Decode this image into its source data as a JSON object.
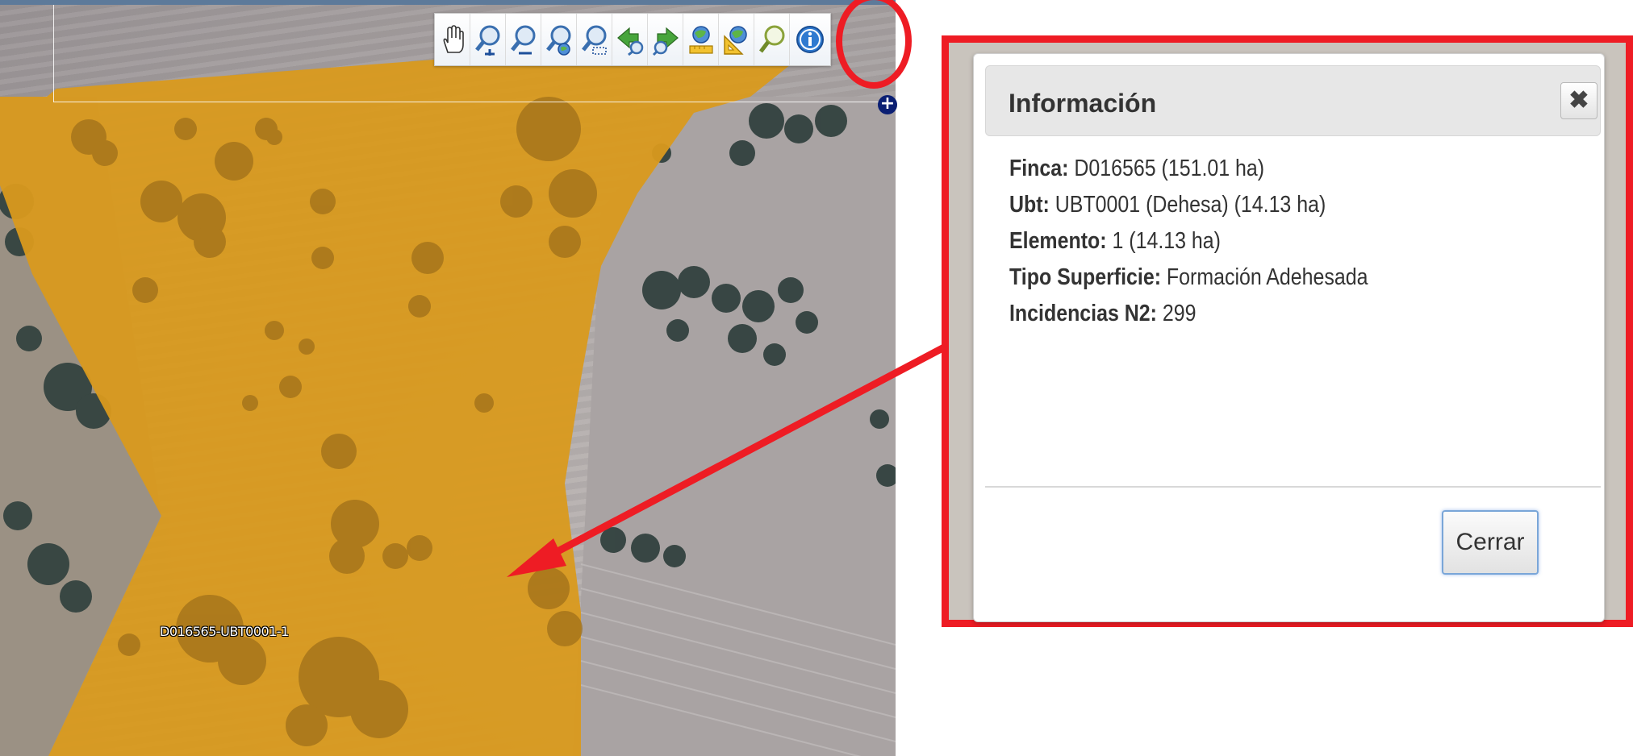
{
  "map": {
    "parcel_label": "D016565-UBT0001-1"
  },
  "toolbar": {
    "tools": [
      {
        "name": "pan-hand-icon"
      },
      {
        "name": "zoom-in-icon"
      },
      {
        "name": "zoom-out-icon"
      },
      {
        "name": "zoom-extent-icon"
      },
      {
        "name": "zoom-box-icon"
      },
      {
        "name": "previous-view-icon"
      },
      {
        "name": "next-view-icon"
      },
      {
        "name": "measure-area-icon"
      },
      {
        "name": "measure-distance-icon"
      },
      {
        "name": "search-icon"
      },
      {
        "name": "info-icon"
      }
    ],
    "expand_label": "+"
  },
  "dialog": {
    "title": "Información",
    "close_symbol": "✖",
    "rows": [
      {
        "label": "Finca:",
        "value": " D016565 (151.01 ha)"
      },
      {
        "label": "Ubt:",
        "value": " UBT0001 (Dehesa) (14.13 ha)"
      },
      {
        "label": "Elemento:",
        "value": " 1 (14.13 ha)"
      },
      {
        "label": "Tipo Superficie:",
        "value": " Formación Adehesada"
      },
      {
        "label": "Incidencias N2:",
        "value": " 299"
      }
    ],
    "close_button": "Cerrar"
  },
  "colors": {
    "highlight_red": "#ee1c24",
    "parcel_fill": "#d99a1e",
    "tree_dark": "#2e3e3a"
  }
}
